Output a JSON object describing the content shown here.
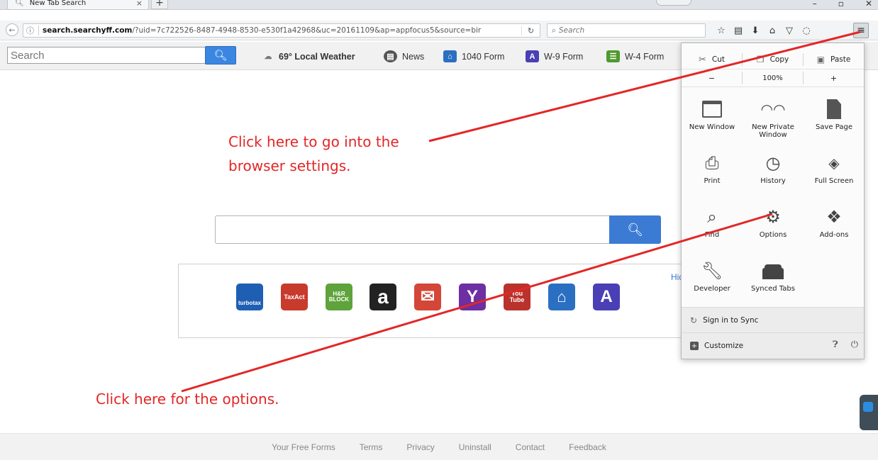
{
  "browser": {
    "tab_title": "New Tab Search",
    "tab_close": "×",
    "new_tab": "+",
    "url_host": "search.searchyff.com",
    "url_path": "/?uid=7c722526-8487-4948-8530-e530f1a42968&uc=20161109&ap=appfocus5&source=bir",
    "search_placeholder": "Search"
  },
  "toolbar": {
    "search_placeholder": "Search",
    "weather": "69° Local Weather",
    "news": "News",
    "form_1040": "1040 Form",
    "form_w9": "W-9 Form",
    "form_w4": "W-4 Form"
  },
  "annotations": {
    "settings_line1": "Click here to go into the",
    "settings_line2": "browser settings.",
    "options": "Click here for the options."
  },
  "shortcuts": {
    "hide_label": "Hide",
    "items": [
      {
        "label": "turbotax",
        "color": "#1f5fb3"
      },
      {
        "label": "TaxAct",
        "color": "#c83a2c"
      },
      {
        "label": "H&R BLOCK",
        "color": "#5ea33b"
      },
      {
        "label": "a",
        "color": "#222222"
      },
      {
        "label": "M",
        "color": "#d44638"
      },
      {
        "label": "Y",
        "color": "#6d2fa1"
      },
      {
        "label": "You Tube",
        "color": "#b9322b"
      },
      {
        "label": "bank",
        "color": "#2b6fc2"
      },
      {
        "label": "A",
        "color": "#4a3fb5"
      }
    ]
  },
  "menu": {
    "cut": "Cut",
    "copy": "Copy",
    "paste": "Paste",
    "zoom_out": "−",
    "zoom_level": "100%",
    "zoom_in": "+",
    "new_window": "New Window",
    "new_private_window": "New Private Window",
    "save_page": "Save Page",
    "print": "Print",
    "history": "History",
    "full_screen": "Full Screen",
    "find": "Find",
    "options": "Options",
    "add_ons": "Add-ons",
    "developer": "Developer",
    "synced_tabs": "Synced Tabs",
    "sign_in": "Sign in to Sync",
    "customize": "Customize"
  },
  "footer": {
    "links": [
      "Your Free Forms",
      "Terms",
      "Privacy",
      "Uninstall",
      "Contact",
      "Feedback"
    ]
  },
  "colors": {
    "annotation_red": "#e32626",
    "accent_blue": "#3b7bd4"
  }
}
